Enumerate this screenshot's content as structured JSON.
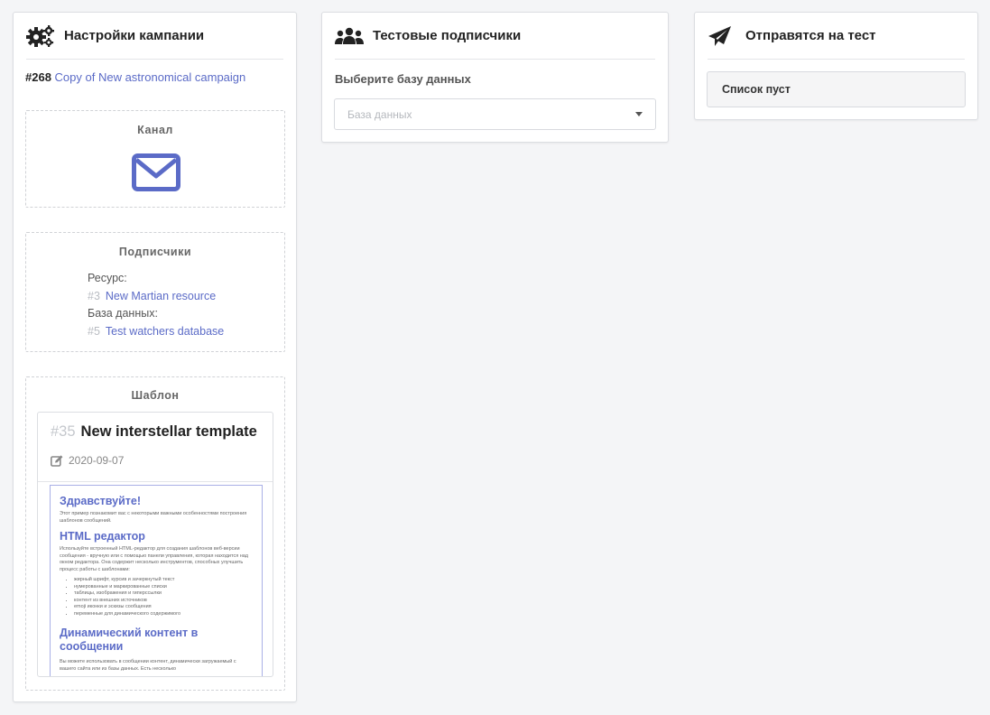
{
  "colors": {
    "accent": "#5b6bc7",
    "muted_id": "#b9bcc2",
    "text": "#333333"
  },
  "settings": {
    "title": "Настройки кампании",
    "icon": "gears-icon",
    "campaign_num": "#268",
    "campaign_name": "Copy of New astronomical campaign",
    "channel": {
      "title": "Канал",
      "icon": "envelope-icon"
    },
    "subscribers": {
      "title": "Подписчики",
      "resource_label": "Ресурс:",
      "resource_id": "#3",
      "resource_name": "New Martian resource",
      "database_label": "База данных:",
      "database_id": "#5",
      "database_name": "Test watchers database"
    },
    "template": {
      "title": "Шаблон",
      "id": "#35",
      "name": "New interstellar template",
      "date": "2020-09-07",
      "preview": {
        "h1": "Здравствуйте!",
        "p1": "Этот пример познакомит вас с некоторыми важными особенностями построения шаблонов сообщений.",
        "h2": "HTML редактор",
        "p2": "Используйте встроенный HTML-редактор для создания шаблонов веб-версии сообщения - вручную или с помощью панели управления, которая находится над окном редактора. Она содержит несколько инструментов, способных улучшить процесс работы с шаблонами:",
        "items": [
          "жирный шрифт, курсив и зачеркнутый текст",
          "нумерованные и маркированные списки",
          "таблицы, изображения и гиперссылки",
          "контент из внешних источников",
          "emoji иконки и эскизы сообщения",
          "переменные для динамического содержимого"
        ],
        "h3": "Динамический контент в сообщении",
        "p3": "Вы можете использовать в сообщении контент, динамически загружаемый с вашего сайта или из базы данных. Есть несколько"
      }
    }
  },
  "test_subscribers": {
    "title": "Тестовые подписчики",
    "icon": "users-icon",
    "db_label": "Выберите базу данных",
    "db_placeholder": "База данных"
  },
  "send_test": {
    "title": "Отправятся на тест",
    "icon": "paper-plane-icon",
    "empty_text": "Список пуст"
  }
}
